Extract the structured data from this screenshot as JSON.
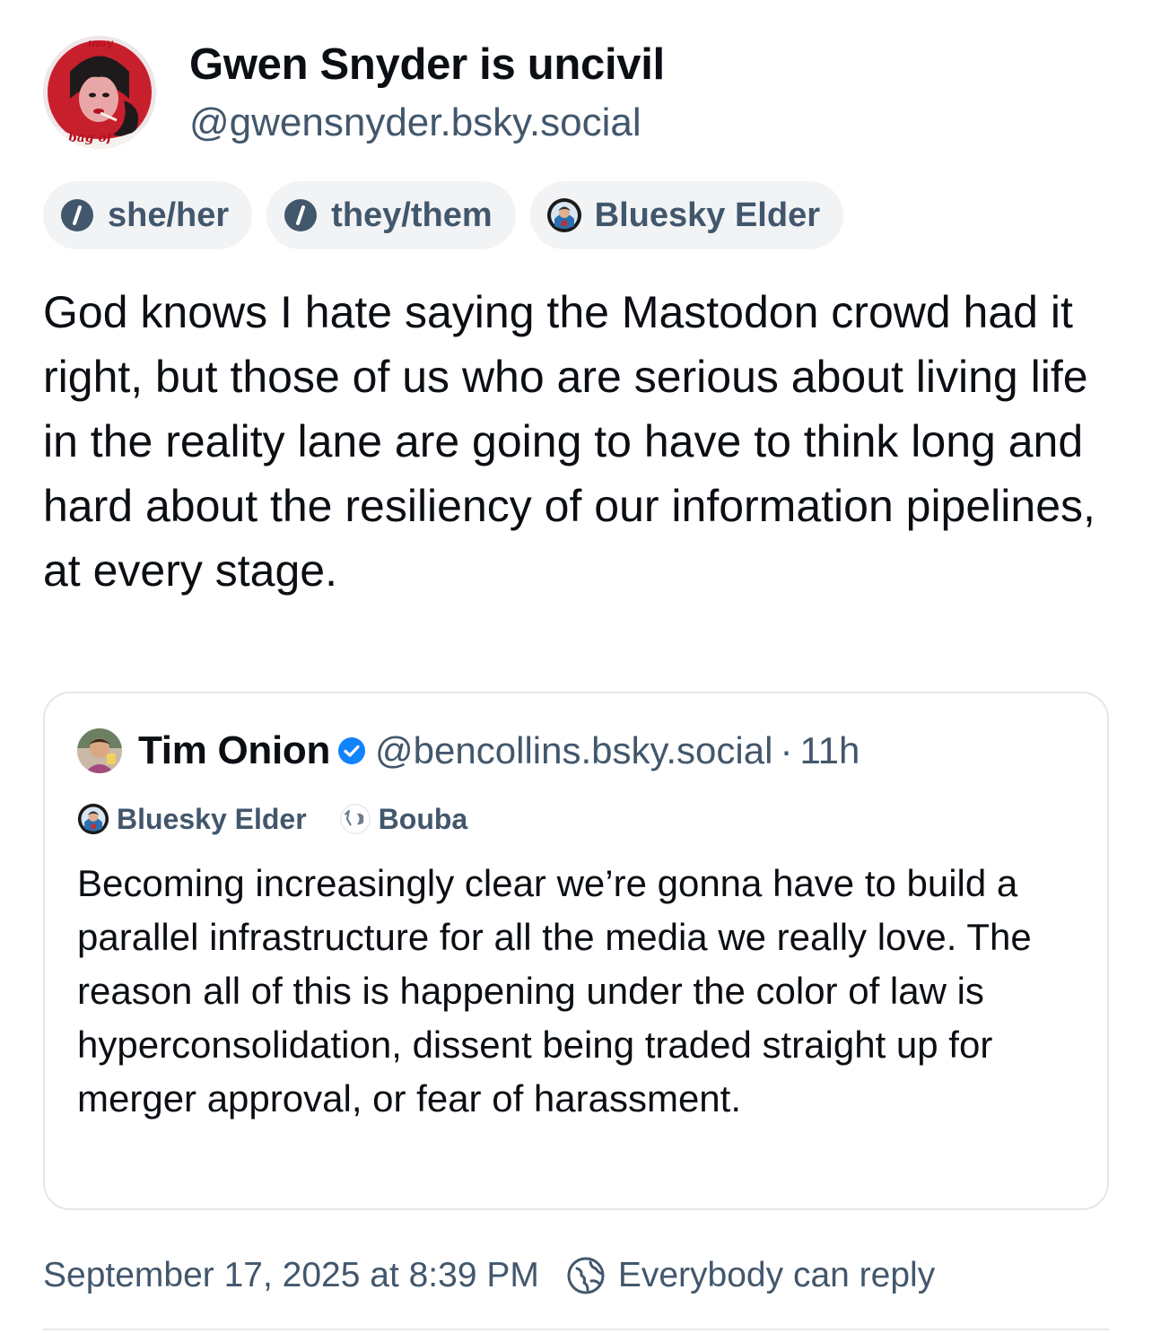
{
  "author": {
    "display_name": "Gwen Snyder is uncivil",
    "handle": "@gwensnyder.bsky.social",
    "avatar_text_top": "may",
    "avatar_text_bottom": "a bag of"
  },
  "labels": [
    {
      "text": "she/her",
      "icon": "info-circle-icon"
    },
    {
      "text": "they/them",
      "icon": "info-circle-icon"
    },
    {
      "text": "Bluesky Elder",
      "icon": "labeler-badge-icon"
    }
  ],
  "post": {
    "text": "God knows I hate saying the Mastodon crowd had it right, but those of us who are serious about living life in the reality lane are going to have to think long and hard about the resiliency of our information pipelines, at every stage."
  },
  "quoted_post": {
    "display_name": "Tim Onion",
    "verified": true,
    "handle": "@bencollins.bsky.social",
    "separator": "·",
    "time": "11h",
    "labels": [
      {
        "text": "Bluesky Elder",
        "icon": "labeler-badge-icon"
      },
      {
        "text": "Bouba",
        "icon": "bouba-icon"
      }
    ],
    "text": "Becoming increasingly clear we’re gonna have to build a parallel infrastructure for all the media we really love. The reason all of this is happening under the color of law is hyperconsolidation, dissent being traded straight up for merger approval, or fear of harassment."
  },
  "footer": {
    "timestamp": "September 17, 2025 at 8:39 PM",
    "reply_setting": "Everybody can reply"
  },
  "colors": {
    "text_primary": "#0b0f14",
    "text_secondary": "#42576c",
    "pill_background": "#f1f3f5",
    "border": "#e3e7ec",
    "verified_blue": "#1083fe"
  }
}
